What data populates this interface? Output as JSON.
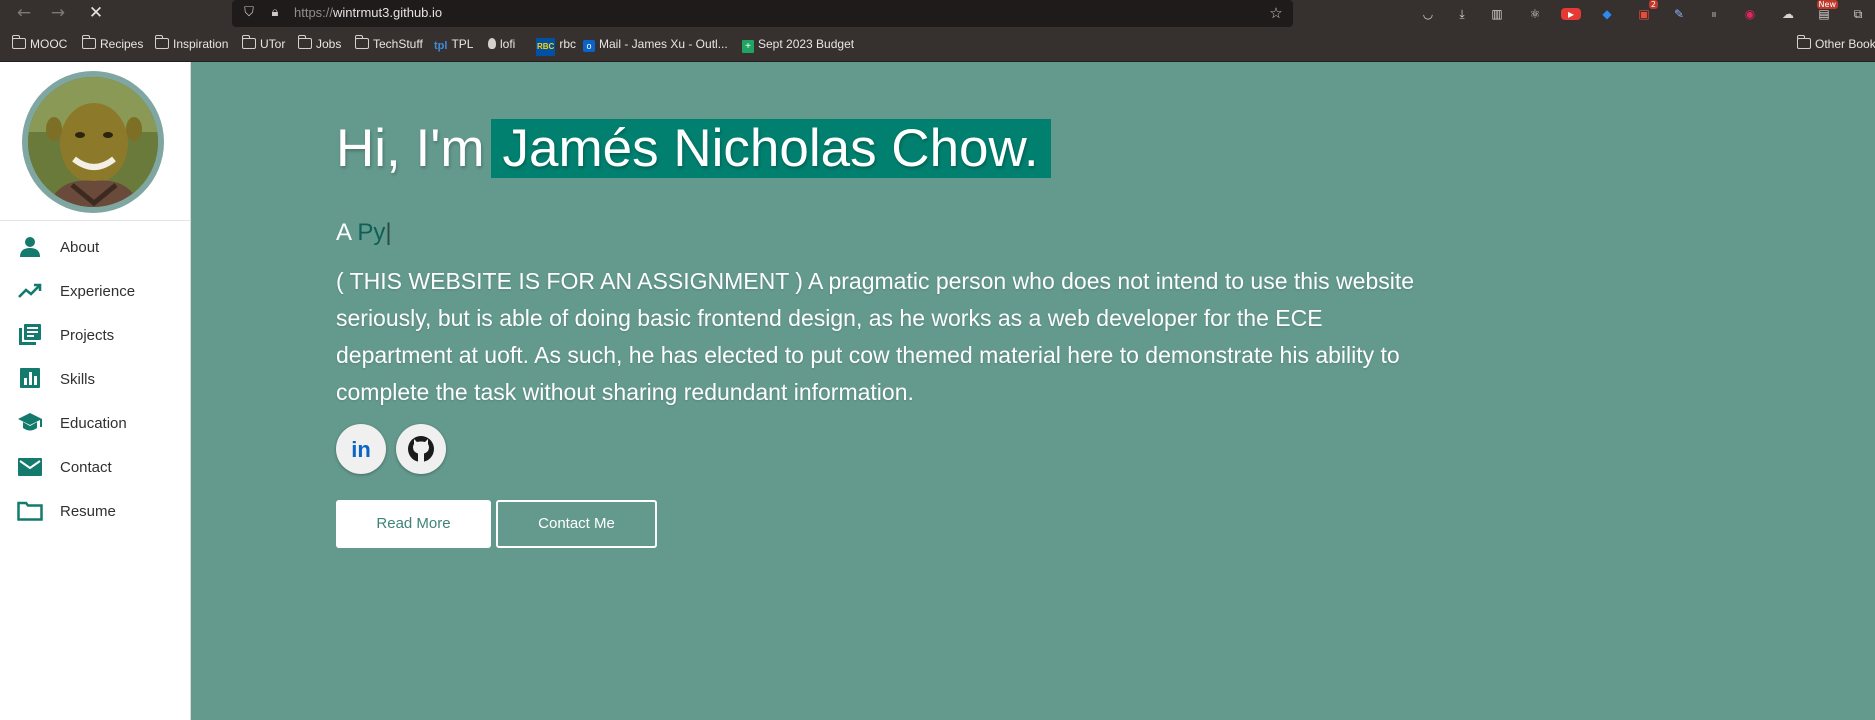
{
  "browser": {
    "url_scheme": "https://",
    "url_host": "wintrmut3.github.io",
    "toolbar_badge_count": "2",
    "toolbar_new_badge": "New",
    "bookmarks": [
      {
        "label": "MOOC",
        "icon": "folder"
      },
      {
        "label": "Recipes",
        "icon": "folder"
      },
      {
        "label": "Inspiration",
        "icon": "folder"
      },
      {
        "label": "UTor",
        "icon": "folder"
      },
      {
        "label": "Jobs",
        "icon": "folder"
      },
      {
        "label": "TechStuff",
        "icon": "folder"
      },
      {
        "label": "TPL",
        "icon": "tpl",
        "icon_text": "tpl"
      },
      {
        "label": "lofi",
        "icon": "lofi"
      },
      {
        "label": "rbc",
        "icon": "rbc",
        "icon_text": "RBC"
      },
      {
        "label": "Mail - James Xu - Outl...",
        "icon": "outlook",
        "icon_text": "o"
      },
      {
        "label": "Sept 2023 Budget",
        "icon": "sheets",
        "icon_text": "+"
      }
    ],
    "other_bookmarks": "Other Book"
  },
  "sidebar": {
    "avatar_alt": "profile avatar",
    "items": [
      {
        "label": "About",
        "icon": "person-icon"
      },
      {
        "label": "Experience",
        "icon": "trending-up-icon"
      },
      {
        "label": "Projects",
        "icon": "library-books-icon"
      },
      {
        "label": "Skills",
        "icon": "bar-chart-icon"
      },
      {
        "label": "Education",
        "icon": "school-icon"
      },
      {
        "label": "Contact",
        "icon": "mail-icon"
      },
      {
        "label": "Resume",
        "icon": "folder-icon"
      }
    ]
  },
  "hero": {
    "greeting": "Hi, I'm",
    "name": "Jamés Nicholas Chow.",
    "subtitle_prefix": "A",
    "typed_text": "Py",
    "typed_cursor": "|",
    "description": "( THIS WEBSITE IS FOR AN ASSIGNMENT ) A pragmatic person who does not intend to use this website seriously, but is able of doing basic frontend design, as he works as a web developer for the ECE department at uoft. As such, he has elected to put cow themed material here to demonstrate his ability to complete the task without sharing redundant information.",
    "social": [
      {
        "name": "linkedin",
        "icon_text": "in"
      },
      {
        "name": "github"
      }
    ],
    "buttons": {
      "read_more": "Read More",
      "contact_me": "Contact Me"
    }
  },
  "colors": {
    "hero_bg": "#649a8e",
    "name_highlight": "#01806f",
    "sidebar_icon": "#137a6d",
    "linkedin": "#0a66c2"
  }
}
